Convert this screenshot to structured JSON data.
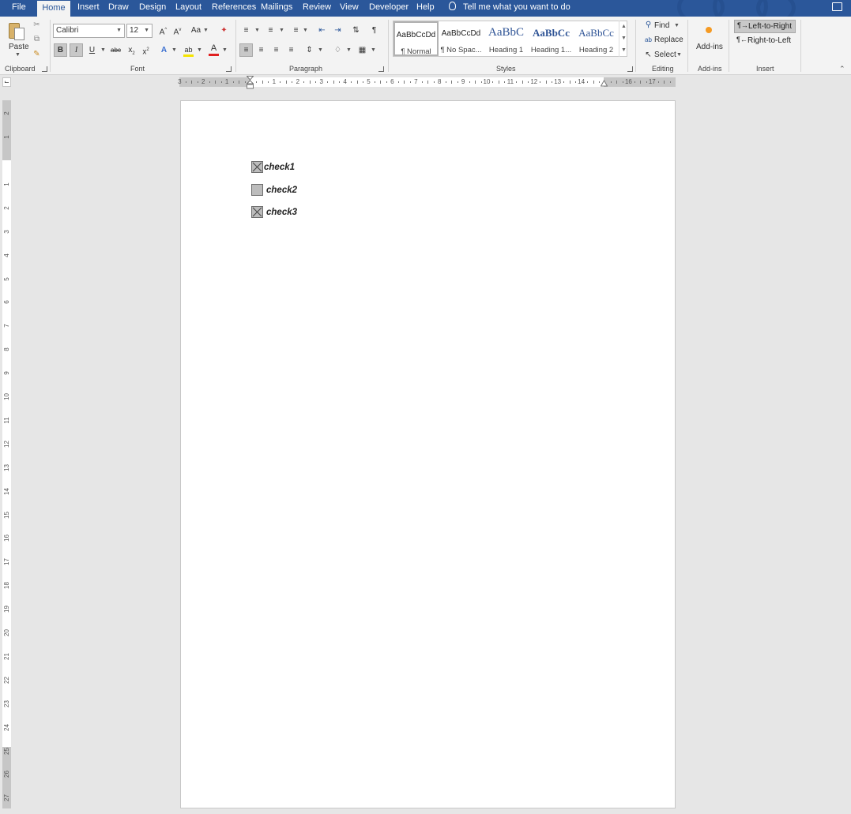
{
  "tabs": {
    "file": "File",
    "home": "Home",
    "insert": "Insert",
    "draw": "Draw",
    "design": "Design",
    "layout": "Layout",
    "references": "References",
    "mailings": "Mailings",
    "review": "Review",
    "view": "View",
    "developer": "Developer",
    "help": "Help",
    "tell_me": "Tell me what you want to do"
  },
  "clipboard": {
    "paste": "Paste",
    "group": "Clipboard"
  },
  "font": {
    "name": "Calibri",
    "size": "12",
    "change_case": "Aa",
    "bold": "B",
    "italic": "I",
    "underline": "U",
    "strike": "abc",
    "subscript": "x",
    "superscript": "x",
    "group": "Font",
    "font_color": "#e02020",
    "highlight_color": "#f5e400"
  },
  "paragraph": {
    "group": "Paragraph"
  },
  "styles": {
    "group": "Styles",
    "items": [
      {
        "preview": "AaBbCcDd",
        "name": "¶ Normal"
      },
      {
        "preview": "AaBbCcDd",
        "name": "¶ No Spac..."
      },
      {
        "preview": "AaBbC",
        "name": "Heading 1"
      },
      {
        "preview": "AaBbCc",
        "name": "Heading 1..."
      },
      {
        "preview": "AaBbCc",
        "name": "Heading 2"
      }
    ]
  },
  "editing": {
    "find": "Find",
    "replace": "Replace",
    "select": "Select",
    "group": "Editing"
  },
  "addins": {
    "label": "Add-ins",
    "group": "Add-ins"
  },
  "insert_group": {
    "ltr": "Left-to-Right",
    "rtl": "Right-to-Left",
    "group": "Insert"
  },
  "ruler": {
    "h_numbers": [
      "3",
      "2",
      "1",
      "",
      "1",
      "2",
      "3",
      "4",
      "5",
      "6",
      "7",
      "8",
      "9",
      "10",
      "11",
      "12",
      "13",
      "14",
      "",
      "16",
      "17"
    ],
    "v_numbers": [
      "2",
      "1",
      "",
      "1",
      "2",
      "3",
      "4",
      "5",
      "6",
      "7",
      "8",
      "9",
      "10",
      "11",
      "12",
      "13",
      "14",
      "15",
      "16",
      "17",
      "18",
      "19",
      "20",
      "21",
      "22",
      "23",
      "24",
      "25",
      "26",
      "27"
    ]
  },
  "document": {
    "checkboxes": [
      {
        "label": "check1",
        "checked": true
      },
      {
        "label": "check2",
        "checked": false
      },
      {
        "label": "check3",
        "checked": true
      }
    ]
  },
  "colors": {
    "brand_blue": "#2b579a",
    "ribbon_bg": "#f3f3f3",
    "canvas_bg": "#e6e6e6"
  }
}
